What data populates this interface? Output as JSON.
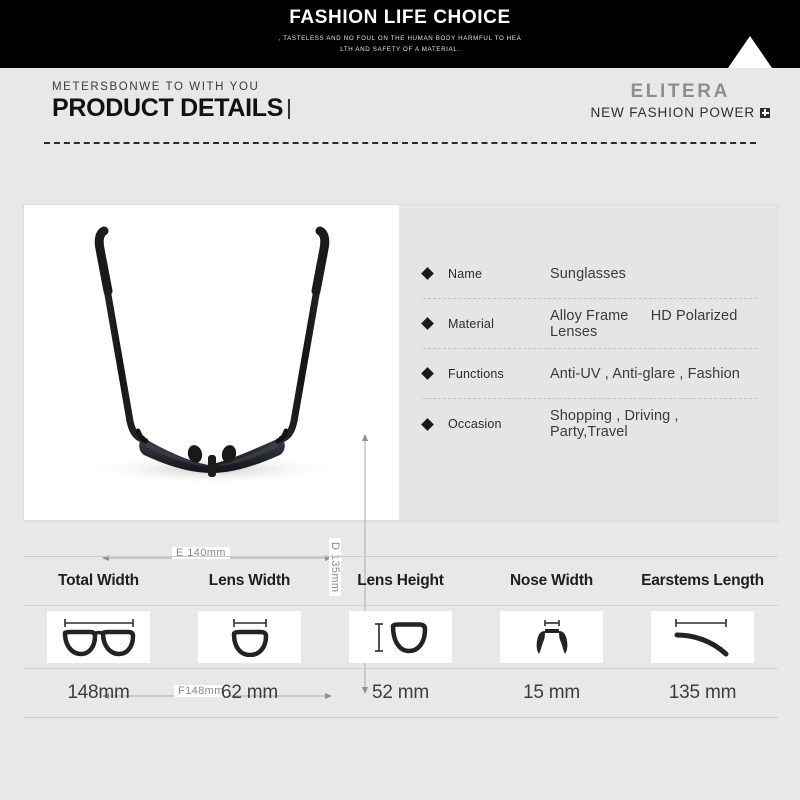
{
  "banner": {
    "title": "FASHION LIFE CHOICE",
    "subtitle_line1": ", TASTELESS AND NO FOUL ON THE HUMAN BODY HARMFUL TO HEA",
    "subtitle_line2": "LTH AND SAFETY OF A MATERIAL.",
    "background": "#000000",
    "triangle_color": "#ffffff"
  },
  "header": {
    "eyebrow": "METERSBONWE TO WITH YOU",
    "title": "PRODUCT DETAILS",
    "brand": "ELITERA",
    "brand_tagline": "NEW FASHION POWER"
  },
  "product_image": {
    "dimension_width_label": "E 140mm",
    "dimension_height_label": "D 135mm",
    "dimension_total_label": "F148mm"
  },
  "specs": [
    {
      "key": "Name",
      "value": "Sunglasses"
    },
    {
      "key": "Material",
      "value": "Alloy Frame",
      "value2": "HD Polarized Lenses"
    },
    {
      "key": "Functions",
      "value": "Anti-UV , Anti-glare , Fashion"
    },
    {
      "key": "Occasion",
      "value": "Shopping , Driving , Party,Travel"
    }
  ],
  "measurements": {
    "headers": [
      "Total Width",
      "Lens Width",
      "Lens Height",
      "Nose Width",
      "Earstems Length"
    ],
    "icons": [
      "glasses-total-width-icon",
      "lens-width-icon",
      "lens-height-icon",
      "nose-width-icon",
      "earstem-length-icon"
    ],
    "values": [
      "148mm",
      "62 mm",
      "52 mm",
      "15 mm",
      "135 mm"
    ]
  },
  "colors": {
    "page_background": "#e8e8e8",
    "panel_background": "#e5e5e5",
    "image_background": "#ffffff",
    "text_dark": "#1f1f1f",
    "text_gray": "#8a8a8a",
    "brand_gray": "#8d8d8d"
  }
}
